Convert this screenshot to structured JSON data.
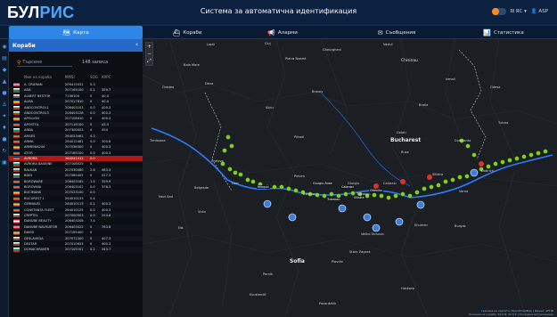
{
  "app": {
    "logo_main": "БУЛ",
    "logo_accent": "РИС",
    "title": "Система за автоматична идентификация",
    "lang": "₪ ЯС ▾",
    "user": "👤 ASP"
  },
  "nav": [
    {
      "icon": "🗺",
      "label": "Карта"
    },
    {
      "icon": "⛴",
      "label": "Кораби"
    },
    {
      "icon": "📢",
      "label": "Аларми"
    },
    {
      "icon": "✉",
      "label": "Съобщения"
    },
    {
      "icon": "📊",
      "label": "Статистика"
    }
  ],
  "panel": {
    "title": "Кораби",
    "close": "‹",
    "search_placeholder": "Търсене",
    "count": "148 записа",
    "columns": {
      "name": "Име на кораба",
      "mmsi": "MMSI",
      "sog": "SOG",
      "course": "КУРС"
    }
  },
  "vessels": [
    {
      "name": "A. CRUMAN",
      "mmsi": "209415431",
      "sog": "5.3",
      "cog": "",
      "flag": [
        "#c2213a",
        "#ffffff",
        "#c2213a"
      ]
    },
    {
      "name": "ADA",
      "mmsi": "207165100",
      "sog": "0.1",
      "cog": "359.7",
      "flag": [
        "#ffffff",
        "#00966e",
        "#d62612"
      ]
    },
    {
      "name": "ALBERT NESTOR",
      "mmsi": "7156100",
      "sog": "0",
      "cog": "40.0",
      "flag": [
        "#ffffff",
        "#00966e",
        "#d62612"
      ]
    },
    {
      "name": "ALMA",
      "mmsi": "207017810",
      "sog": "0",
      "cog": "40.0",
      "flag": [
        "#002b7f",
        "#fcd116",
        "#ce1126"
      ]
    },
    {
      "name": "ANDCONTROL1",
      "mmsi": "206403103",
      "sog": "0.0",
      "cog": "400.3",
      "flag": [
        "#ffffff",
        "#00966e",
        "#d62612"
      ]
    },
    {
      "name": "ANDCONTROL3",
      "mmsi": "206403128",
      "sog": "0.0",
      "cog": "400.3",
      "flag": [
        "#ffffff",
        "#00966e",
        "#d62612"
      ]
    },
    {
      "name": "APOLLON",
      "mmsi": "207108010",
      "sog": "0",
      "cog": "400.3",
      "flag": [
        "#002b7f",
        "#fcd116",
        "#ce1126"
      ]
    },
    {
      "name": "APOSTOL",
      "mmsi": "207116100",
      "sog": "0",
      "cog": "43.5",
      "flag": [
        "#002b7f",
        "#fcd116",
        "#ce1126"
      ]
    },
    {
      "name": "ARDA",
      "mmsi": "207300003",
      "sog": "0",
      "cog": "454",
      "flag": [
        "#ffffff",
        "#00966e",
        "#d62612"
      ]
    },
    {
      "name": "ARGES",
      "mmsi": "264023461",
      "sog": "4.3",
      "cog": "",
      "flag": [
        "#002b7f",
        "#fcd116",
        "#ce1126"
      ]
    },
    {
      "name": "ARMA",
      "mmsi": "264012461",
      "sog": "0.0",
      "cog": "300.8",
      "flag": [
        "#002b7f",
        "#fcd116",
        "#ce1126"
      ]
    },
    {
      "name": "ARMENIA200",
      "mmsi": "207036300",
      "sog": "0",
      "cog": "400.3",
      "flag": [
        "#002b7f",
        "#fcd116",
        "#ce1126"
      ]
    },
    {
      "name": "ATOR",
      "mmsi": "207185100",
      "sog": "0.0",
      "cog": "400.3",
      "flag": [
        "#002b7f",
        "#fcd116",
        "#ce1126"
      ]
    },
    {
      "name": "AVRORA",
      "mmsi": "264041412",
      "sog": "0.0",
      "cog": "",
      "flag": [
        "#002b7f",
        "#fcd116",
        "#ce1126"
      ],
      "selected": true
    },
    {
      "name": "AVRORA BASKINE",
      "mmsi": "207108025",
      "sog": "0",
      "cog": "",
      "flag": [
        "#ffffff",
        "#00966e",
        "#d62612"
      ]
    },
    {
      "name": "BALKAN",
      "mmsi": "207030080",
      "sog": "2.8",
      "cog": "483.3",
      "flag": [
        "#ffffff",
        "#00966e",
        "#d62612"
      ]
    },
    {
      "name": "BDIN",
      "mmsi": "207065405",
      "sog": "0",
      "cog": "527.3",
      "flag": [
        "#ffffff",
        "#00966e",
        "#d62612"
      ]
    },
    {
      "name": "BOROWARE",
      "mmsi": "206403185",
      "sog": "1.5",
      "cog": "359.9",
      "flag": [
        "#002b7f",
        "#fcd116",
        "#ce1126"
      ]
    },
    {
      "name": "BOROVNIA",
      "mmsi": "206403102",
      "sog": "0.0",
      "cog": "378.3",
      "flag": [
        "#002b7f",
        "#fcd116",
        "#ce1126"
      ]
    },
    {
      "name": "BUCIMANS",
      "mmsi": "207023100",
      "sog": "0.0",
      "cog": "",
      "flag": [
        "#002b7f",
        "#fcd116",
        "#ce1126"
      ]
    },
    {
      "name": "BUCUREST 1",
      "mmsi": "264010133",
      "sog": "0.4",
      "cog": "",
      "flag": [
        "#002b7f",
        "#fcd116",
        "#ce1126"
      ]
    },
    {
      "name": "CERNAVEI",
      "mmsi": "264010113",
      "sog": "0.1",
      "cog": "400.3",
      "flag": [
        "#002b7f",
        "#fcd116",
        "#ce1126"
      ]
    },
    {
      "name": "CONSTANTA FLEET",
      "mmsi": "264010125",
      "sog": "0.0",
      "cog": "400.3",
      "flag": [
        "#002b7f",
        "#fcd116",
        "#ce1126"
      ]
    },
    {
      "name": "CRYPTEL",
      "mmsi": "207000503",
      "sog": "0.0",
      "cog": "254.8",
      "flag": [
        "#ffffff",
        "#00966e",
        "#d62612"
      ]
    },
    {
      "name": "DANUBE BEAUTY",
      "mmsi": "206403208",
      "sog": "7.4",
      "cog": "",
      "flag": [
        "#c8102e",
        "#ffffff",
        "#c8102e"
      ]
    },
    {
      "name": "DANUBE NAVIGATOR",
      "mmsi": "206403022",
      "sog": "0",
      "cog": "763.8",
      "flag": [
        "#c8102e",
        "#ffffff",
        "#c8102e"
      ]
    },
    {
      "name": "DAVID",
      "mmsi": "207165400",
      "sog": "0",
      "cog": "",
      "flag": [
        "#002b7f",
        "#fcd116",
        "#ce1126"
      ]
    },
    {
      "name": "DESLAVEDA",
      "mmsi": "207072300",
      "sog": "0",
      "cog": "407.3",
      "flag": [
        "#ffffff",
        "#00966e",
        "#d62612"
      ]
    },
    {
      "name": "DESTAR",
      "mmsi": "207010653",
      "sog": "0",
      "cog": "400.3",
      "flag": [
        "#ffffff",
        "#00966e",
        "#d62612"
      ]
    },
    {
      "name": "DOMACHRAVER",
      "mmsi": "207105101",
      "sog": "0.2",
      "cog": "343.7",
      "flag": [
        "#ffffff",
        "#00966e",
        "#d62612"
      ]
    }
  ],
  "map_labels": [
    {
      "t": "Lapti",
      "c": ""
    },
    {
      "t": "Baia Mare",
      "c": ""
    },
    {
      "t": "Cluj",
      "c": ""
    },
    {
      "t": "Gheorgheni",
      "c": ""
    },
    {
      "t": "Piatra Neamt",
      "c": ""
    },
    {
      "t": "Vaslui",
      "c": ""
    },
    {
      "t": "Chisinau",
      "c": "mid"
    },
    {
      "t": "Oradea",
      "c": ""
    },
    {
      "t": "Timisoara",
      "c": ""
    },
    {
      "t": "Deva",
      "c": ""
    },
    {
      "t": "Sibiu",
      "c": ""
    },
    {
      "t": "Brasov",
      "c": ""
    },
    {
      "t": "Galati",
      "c": ""
    },
    {
      "t": "Bucharest",
      "c": "big"
    },
    {
      "t": "Craiova",
      "c": ""
    },
    {
      "t": "Pitesti",
      "c": ""
    },
    {
      "t": "Constanta",
      "c": ""
    },
    {
      "t": "Ruse",
      "c": ""
    },
    {
      "t": "Pleven",
      "c": ""
    },
    {
      "t": "Varna",
      "c": ""
    },
    {
      "t": "Burgas",
      "c": ""
    },
    {
      "t": "Sofia",
      "c": "big"
    },
    {
      "t": "Plovdiv",
      "c": ""
    },
    {
      "t": "Stara Zagora",
      "c": ""
    },
    {
      "t": "Veliko Tarnovo",
      "c": ""
    },
    {
      "t": "Vidin",
      "c": ""
    },
    {
      "t": "Nis",
      "c": ""
    },
    {
      "t": "Belgrade",
      "c": ""
    },
    {
      "t": "Novi Sad",
      "c": ""
    },
    {
      "t": "Shumen",
      "c": ""
    },
    {
      "t": "Odesa",
      "c": ""
    },
    {
      "t": "Izmail",
      "c": ""
    },
    {
      "t": "Tulcea",
      "c": ""
    },
    {
      "t": "Braila",
      "c": ""
    },
    {
      "t": "Pernik",
      "c": ""
    },
    {
      "t": "Kyustendil",
      "c": ""
    },
    {
      "t": "Haskovo",
      "c": ""
    },
    {
      "t": "Pazardzhik",
      "c": ""
    },
    {
      "t": "Dobrich",
      "c": ""
    },
    {
      "t": "Silistra",
      "c": ""
    },
    {
      "t": "Lom",
      "c": ""
    },
    {
      "t": "Svishtov",
      "c": ""
    },
    {
      "t": "Tutrakan",
      "c": ""
    },
    {
      "t": "Giurgiu",
      "c": ""
    },
    {
      "t": "Calarasi",
      "c": ""
    }
  ],
  "map_river_labels": [
    "Giurgiu-Ruse",
    "Calarasi",
    "Oltenita",
    "Tutrakan",
    "Silistra",
    "Nikopol"
  ],
  "attribution": {
    "line1": "Граница на картата: OpenStreetMap | Данни: АППД",
    "line2": "Локация на кораба: 44.0 N, 25.9 E | Последна актуализация"
  },
  "colors": {
    "accent": "#2e86e6",
    "river": "#2b7cff",
    "vessel": "#7ed321",
    "alert": "#e0302a"
  }
}
